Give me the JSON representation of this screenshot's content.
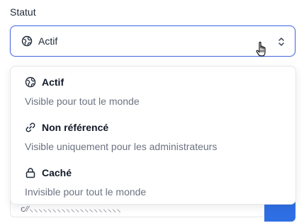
{
  "field": {
    "label": "Statut",
    "selected_value": "Actif",
    "selected_icon": "globe-icon"
  },
  "menu": {
    "options": [
      {
        "title": "Actif",
        "description": "Visible pour tout le monde",
        "icon": "globe-icon"
      },
      {
        "title": "Non référencé",
        "description": "Visible uniquement pour les administrateurs",
        "icon": "link-icon"
      },
      {
        "title": "Caché",
        "description": "Invisible pour tout le monde",
        "icon": "lock-icon"
      }
    ]
  },
  "colors": {
    "accent_border": "#4a6ee0",
    "primary_button": "#2f6fe4",
    "muted_text": "#6b7280"
  }
}
